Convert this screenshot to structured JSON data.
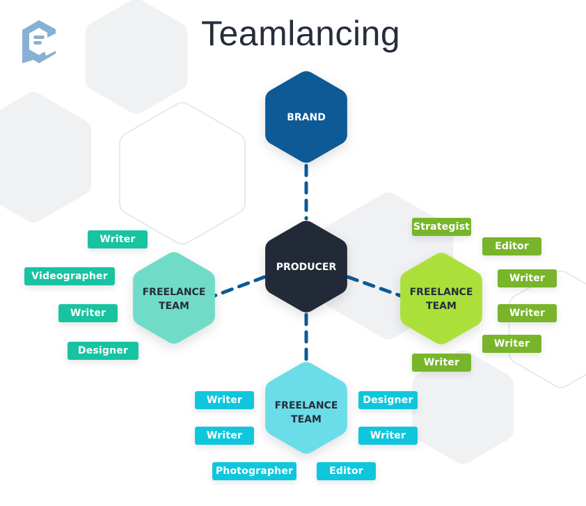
{
  "title": "Teamlancing",
  "logo": {
    "icon": "contently-logo-icon",
    "color": "#88b0d4"
  },
  "colors": {
    "brand": "#0c5a96",
    "producer": "#242a37",
    "team_teal": "#6fdcc7",
    "team_green": "#abe03b",
    "team_cyan": "#6adde9",
    "tag_teal": "#17c3a0",
    "tag_green": "#78b52a",
    "tag_cyan": "#10c6dd",
    "connector": "#0c5a96",
    "bg_hex_fill": "#f0f1f3",
    "bg_hex_outline": "#e3eaf2"
  },
  "nodes": {
    "brand": {
      "label": "BRAND"
    },
    "producer": {
      "label": "PRODUCER"
    },
    "team_left": {
      "line1": "FREELANCE",
      "line2": "TEAM"
    },
    "team_right": {
      "line1": "FREELANCE",
      "line2": "TEAM"
    },
    "team_bottom": {
      "line1": "FREELANCE",
      "line2": "TEAM"
    }
  },
  "connections": [
    {
      "from": "brand",
      "to": "producer",
      "style": "dashed"
    },
    {
      "from": "producer",
      "to": "team_left",
      "style": "dashed"
    },
    {
      "from": "producer",
      "to": "team_right",
      "style": "dashed"
    },
    {
      "from": "producer",
      "to": "team_bottom",
      "style": "dashed"
    }
  ],
  "teams": {
    "left": {
      "roles": [
        "Writer",
        "Videographer",
        "Writer",
        "Designer"
      ]
    },
    "right": {
      "roles": [
        "Strategist",
        "Editor",
        "Writer",
        "Writer",
        "Writer",
        "Writer"
      ]
    },
    "bottom": {
      "roles": [
        "Writer",
        "Designer",
        "Writer",
        "Writer",
        "Photographer",
        "Editor"
      ]
    }
  }
}
